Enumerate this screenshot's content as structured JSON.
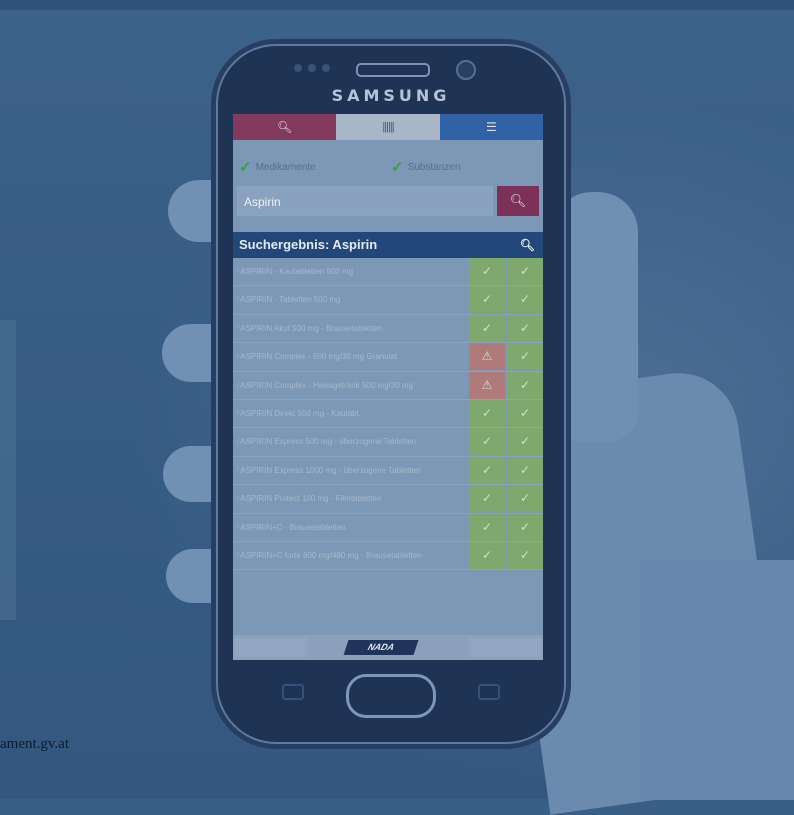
{
  "device": {
    "brand": "SAMSUNG"
  },
  "app": {
    "tabs": [
      {
        "name": "search",
        "icon": "search-icon"
      },
      {
        "name": "scan",
        "icon": "barcode-icon"
      },
      {
        "name": "list",
        "icon": "list-icon"
      }
    ],
    "filters": [
      {
        "label": "Medikamente",
        "checked": true
      },
      {
        "label": "Substanzen",
        "checked": true
      }
    ],
    "search": {
      "value": "Aspirin",
      "button_icon": "search-icon"
    },
    "results_header": "Suchergebnis: Aspirin",
    "results": [
      {
        "label": "ASPIRIN - Kautabletten 500 mg",
        "status": [
          "ok",
          "ok"
        ]
      },
      {
        "label": "ASPIRIN - Tabletten 500 mg",
        "status": [
          "ok",
          "ok"
        ]
      },
      {
        "label": "ASPIRIN Akut 500 mg - Brausetabletten",
        "status": [
          "ok",
          "ok"
        ]
      },
      {
        "label": "ASPIRIN Complex - 500 mg/30 mg Granulat",
        "status": [
          "warn",
          "ok"
        ]
      },
      {
        "label": "ASPIRIN Complex - Heissgetränk 500 mg/30 mg",
        "status": [
          "warn",
          "ok"
        ]
      },
      {
        "label": "ASPIRIN Direkt 500 mg - Kautabl.",
        "status": [
          "ok",
          "ok"
        ]
      },
      {
        "label": "ASPIRIN Express 500 mg - überzogene Tabletten",
        "status": [
          "ok",
          "ok"
        ]
      },
      {
        "label": "ASPIRIN Express 1000 mg - überzogene Tabletten",
        "status": [
          "ok",
          "ok"
        ]
      },
      {
        "label": "ASPIRIN Protect 100 mg - Filmtabletten",
        "status": [
          "ok",
          "ok"
        ]
      },
      {
        "label": "ASPIRIN+C - Brausetabletten",
        "status": [
          "ok",
          "ok"
        ]
      },
      {
        "label": "ASPIRIN+C forte 800 mg/480 mg - Brausetabletten",
        "status": [
          "ok",
          "ok"
        ]
      }
    ],
    "footer_logo": "NADA"
  },
  "caption": "ament.gv.at",
  "colors": {
    "overlay": "#3a5f86",
    "tab_search": "#843a5e",
    "tab_list": "#3262a6",
    "header": "#24477a",
    "ok": "#7fa86f",
    "warn": "#b07a7a"
  }
}
